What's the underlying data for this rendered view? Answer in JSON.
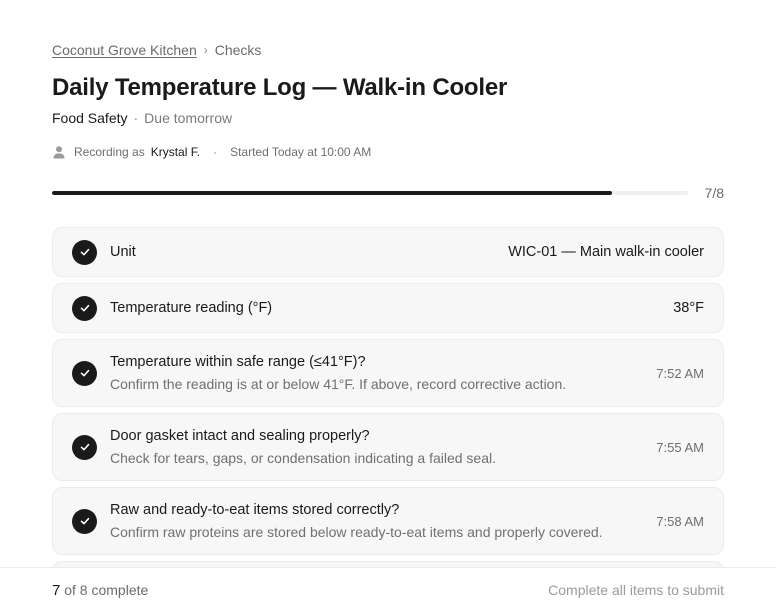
{
  "breadcrumb": {
    "location": "Coconut Grove Kitchen",
    "separator": "›",
    "current": "Checks"
  },
  "page": {
    "title": "Daily Temperature Log — Walk-in Cooler",
    "category": "Food Safety",
    "separator": "·",
    "due": "Due tomorrow"
  },
  "recording": {
    "icon": "user-icon",
    "prefix": "Recording as",
    "user": "Krystal F.",
    "separator": "·",
    "started": "Started Today at 10:00 AM"
  },
  "progress": {
    "completed": 7,
    "total": 8,
    "label": "7/8",
    "fraction": 0.88
  },
  "items": [
    {
      "title": "Unit",
      "description": "",
      "value": "WIC-01 — Main walk-in cooler",
      "time": "",
      "done": true
    },
    {
      "title": "Temperature reading (°F)",
      "description": "",
      "value": "38°F",
      "time": "",
      "done": true
    },
    {
      "title": "Temperature within safe range (≤41°F)?",
      "description": "Confirm the reading is at or below 41°F. If above, record corrective action.",
      "value": "",
      "time": "7:52 AM",
      "done": true
    },
    {
      "title": "Door gasket intact and sealing properly?",
      "description": "Check for tears, gaps, or condensation indicating a failed seal.",
      "value": "",
      "time": "7:55 AM",
      "done": true
    },
    {
      "title": "Raw and ready-to-eat items stored correctly?",
      "description": "Confirm raw proteins are stored below ready-to-eat items and properly covered.",
      "value": "",
      "time": "7:58 AM",
      "done": true
    }
  ],
  "footer": {
    "completed": "7",
    "suffix": "of 8 complete",
    "submit_hint": "Complete all items to submit"
  },
  "colors": {
    "accent": "#1a1a1a",
    "card_bg": "#f7f7f7",
    "muted": "#6b6b6b"
  }
}
